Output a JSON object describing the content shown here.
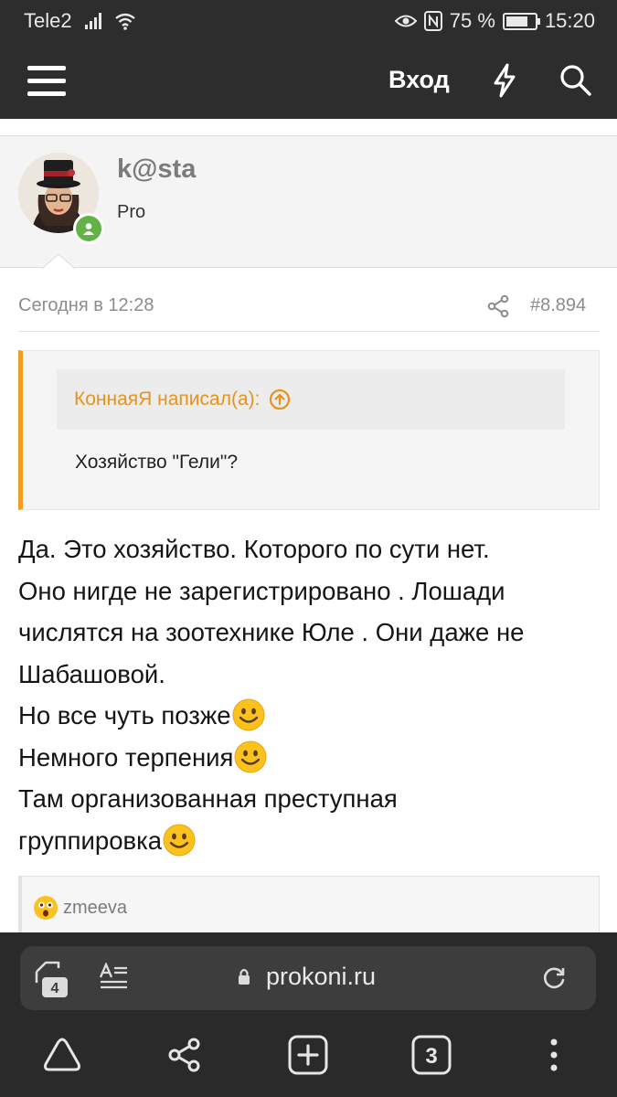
{
  "status_bar": {
    "carrier": "Tele2",
    "battery": "75 %",
    "battery_level": 0.75,
    "time": "15:20",
    "icons": [
      "signal-icon",
      "wifi-icon",
      "eye-comfort-icon",
      "nfc-icon",
      "battery-icon"
    ]
  },
  "header": {
    "menu_icon": "hamburger-icon",
    "login_label": "Вход",
    "icons": [
      "lightning-icon",
      "search-icon"
    ]
  },
  "user": {
    "name": "k@sta",
    "role": "Pro",
    "online": true
  },
  "post": {
    "time": "Сегодня в 12:28",
    "number": "#8.894",
    "quote": {
      "author": "КоннаяЯ написал(а):",
      "text": "Хозяйство \"Гели\"?"
    },
    "lines": [
      "Да. Это хозяйство. Которого по сути нет.",
      "Оно нигде не зарегистрировано . Лошади",
      "числятся на зоотехнике Юле . Они даже не",
      "Шабашовой.",
      "Но все чуть позже",
      "Немного терпения",
      "Там организованная преступная",
      "группировка"
    ],
    "reactions": {
      "user": "zmeeva",
      "emoji": "astonished-icon"
    }
  },
  "browser": {
    "tab_count": "4",
    "url": "prokoni.ru",
    "tabs_button": "3",
    "icons": [
      "tabs-icon",
      "reader-mode-icon",
      "lock-icon",
      "reload-icon",
      "home-icon",
      "share-icon",
      "new-tab-icon",
      "tab-switcher-icon",
      "more-icon"
    ]
  },
  "colors": {
    "bar_bg": "#2d2d2d",
    "quote_accent": "#f0a020",
    "online": "#63b245"
  }
}
